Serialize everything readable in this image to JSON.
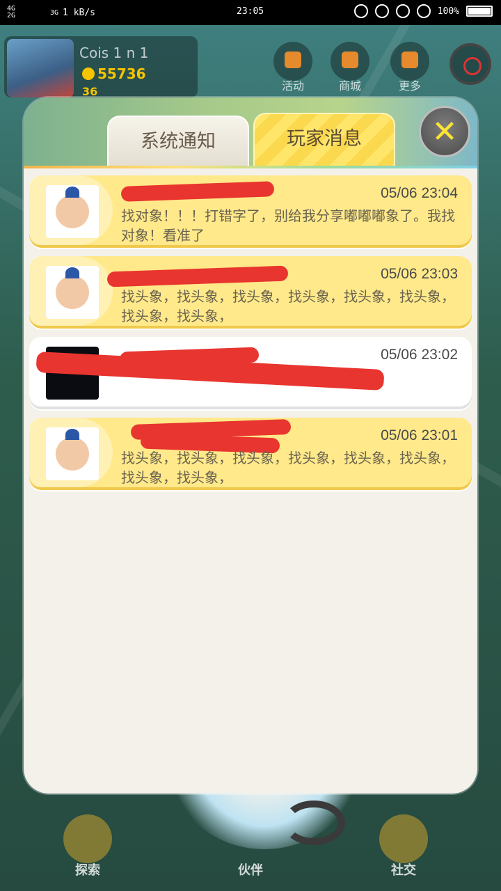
{
  "status_bar": {
    "network_1": "4G",
    "network_2": "2G",
    "network_3": "3G",
    "speed": "1 kB/s",
    "time": "23:05",
    "battery": "100%"
  },
  "player": {
    "name": "Cois 1 n 1",
    "coins": "55736",
    "level": "36"
  },
  "top_buttons": [
    {
      "label": "活动",
      "icon": "gift-icon"
    },
    {
      "label": "商城",
      "icon": "shop-icon"
    },
    {
      "label": "更多",
      "icon": "more-icon"
    }
  ],
  "bottom_nav": [
    {
      "label": "探索",
      "icon": "map-pin-icon"
    },
    {
      "label": "伙伴",
      "icon": "partner-icon"
    },
    {
      "label": "社交",
      "icon": "social-icon"
    }
  ],
  "modal": {
    "tabs": [
      {
        "label": "系统通知",
        "active": false
      },
      {
        "label": "玩家消息",
        "active": true
      }
    ],
    "close_icon": "✕",
    "messages": [
      {
        "sender": "",
        "time": "05/06 23:04",
        "body": "找对象！！！打错字了，别给我分享嘟嘟嘟象了。我找对象！看准了",
        "style": "yellow",
        "avatar": "cartoon-avatar"
      },
      {
        "sender": "",
        "time": "05/06 23:03",
        "body": "找头象，找头象，找头象，找头象，找头象，找头象，找头象，找头象，",
        "style": "yellow",
        "avatar": "cartoon-avatar"
      },
      {
        "sender": "",
        "time": "05/06 23:02",
        "body": "",
        "style": "white",
        "avatar": "dark-avatar"
      },
      {
        "sender": "",
        "time": "05/06 23:01",
        "body": "找头象，找头象，找头象，找头象，找头象，找头象，找头象，找头象，",
        "style": "yellow",
        "avatar": "cartoon-avatar"
      }
    ]
  },
  "colors": {
    "tab_active": "#ffe56a",
    "message_yellow": "#ffe98a",
    "redaction": "#e8352f",
    "close_x": "#ffe433"
  }
}
